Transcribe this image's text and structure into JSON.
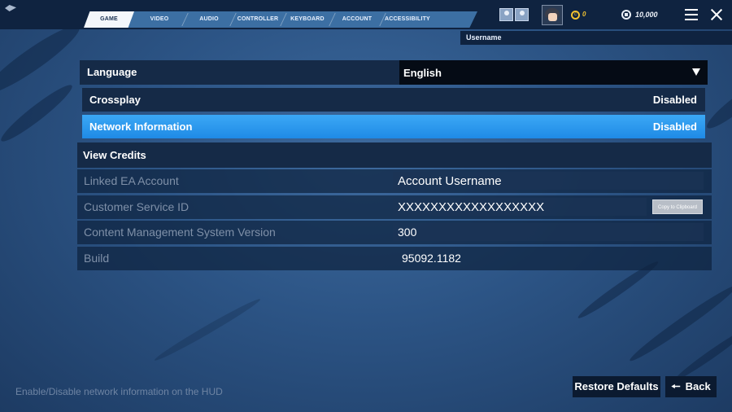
{
  "tabs": [
    "GAME",
    "VIDEO",
    "AUDIO",
    "CONTROLLER",
    "KEYBOARD",
    "ACCOUNT",
    "ACCESSIBILITY"
  ],
  "header": {
    "username": "Username",
    "coin_value": "0",
    "vbucks_value": "10,000"
  },
  "settings": {
    "language": {
      "label": "Language",
      "value": "English"
    },
    "crossplay": {
      "label": "Crossplay",
      "value": "Disabled"
    },
    "network_info": {
      "label": "Network Information",
      "value": "Disabled"
    },
    "view_credits": {
      "label": "View Credits"
    }
  },
  "info": {
    "linked_ea": {
      "label": "Linked EA Account",
      "value": "Account Username"
    },
    "customer_service": {
      "label": "Customer Service ID",
      "value": "XXXXXXXXXXXXXXXXXX",
      "copy_label": "Copy to Clipboard"
    },
    "cms_version": {
      "label": "Content Management System Version",
      "value": "300"
    },
    "build": {
      "label": "Build",
      "value": "95092.1182"
    }
  },
  "footer": {
    "hint": "Enable/Disable network information on the HUD",
    "restore_label": "Restore Defaults",
    "back_label": "Back"
  },
  "colors": {
    "selected_row": "#2a97ee",
    "coin": "#f2c230",
    "background": "#2c5485"
  }
}
